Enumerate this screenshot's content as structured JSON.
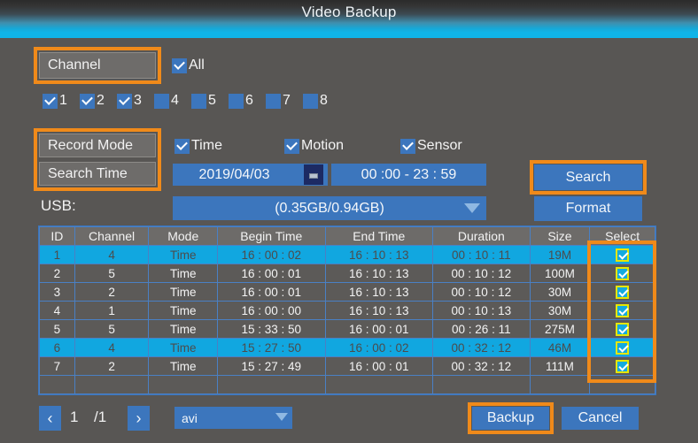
{
  "window": {
    "title": "Video Backup"
  },
  "colors": {
    "background": "#585654",
    "accent_blue": "#3c76bd",
    "highlight_orange": "#f08a1a",
    "row_selected_cyan": "#11a7e0",
    "title_accent": "#0fb4e8",
    "check_border_yellow": "#e6e600"
  },
  "channel_section": {
    "label": "Channel",
    "all": {
      "label": "All",
      "checked": true
    },
    "channels": [
      {
        "label": "1",
        "checked": true
      },
      {
        "label": "2",
        "checked": true
      },
      {
        "label": "3",
        "checked": true
      },
      {
        "label": "4",
        "checked": false
      },
      {
        "label": "5",
        "checked": false
      },
      {
        "label": "6",
        "checked": false
      },
      {
        "label": "7",
        "checked": false
      },
      {
        "label": "8",
        "checked": false
      }
    ]
  },
  "record_mode": {
    "label": "Record Mode",
    "modes": [
      {
        "label": "Time",
        "checked": true
      },
      {
        "label": "Motion",
        "checked": true
      },
      {
        "label": "Sensor",
        "checked": true
      }
    ]
  },
  "search_time": {
    "label": "Search Time",
    "date": "2019/04/03",
    "calendar_icon": "calendar-icon",
    "time_range": "00 :00  -  23 : 59",
    "start_time": "00:00",
    "end_time": "23:59"
  },
  "usb": {
    "label": "USB:",
    "value": "(0.35GB/0.94GB)",
    "used_gb": "0.35GB",
    "total_gb": "0.94GB"
  },
  "actions": {
    "search": "Search",
    "format": "Format",
    "backup": "Backup",
    "cancel": "Cancel"
  },
  "table": {
    "columns": [
      "ID",
      "Channel",
      "Mode",
      "Begin Time",
      "End Time",
      "Duration",
      "Size",
      "Select"
    ],
    "rows": [
      {
        "id": "1",
        "channel": "4",
        "mode": "Time",
        "begin": "16 : 00 : 02",
        "end": "16 : 10 : 13",
        "duration": "00 : 10 : 11",
        "size": "19M",
        "select": true,
        "highlighted": true
      },
      {
        "id": "2",
        "channel": "5",
        "mode": "Time",
        "begin": "16 : 00 : 01",
        "end": "16 : 10 : 13",
        "duration": "00 : 10 : 12",
        "size": "100M",
        "select": true,
        "highlighted": false
      },
      {
        "id": "3",
        "channel": "2",
        "mode": "Time",
        "begin": "16 : 00 : 01",
        "end": "16 : 10 : 13",
        "duration": "00 : 10 : 12",
        "size": "30M",
        "select": true,
        "highlighted": false
      },
      {
        "id": "4",
        "channel": "1",
        "mode": "Time",
        "begin": "16 : 00 : 00",
        "end": "16 : 10 : 13",
        "duration": "00 : 10 : 13",
        "size": "30M",
        "select": true,
        "highlighted": false
      },
      {
        "id": "5",
        "channel": "5",
        "mode": "Time",
        "begin": "15 : 33 : 50",
        "end": "16 : 00 : 01",
        "duration": "00 : 26 : 11",
        "size": "275M",
        "select": true,
        "highlighted": false
      },
      {
        "id": "6",
        "channel": "4",
        "mode": "Time",
        "begin": "15 : 27 : 50",
        "end": "16 : 00 : 02",
        "duration": "00 : 32 : 12",
        "size": "46M",
        "select": true,
        "highlighted": true
      },
      {
        "id": "7",
        "channel": "2",
        "mode": "Time",
        "begin": "15 : 27 : 49",
        "end": "16 : 00 : 01",
        "duration": "00 : 32 : 12",
        "size": "111M",
        "select": true,
        "highlighted": false
      },
      {
        "id": "",
        "channel": "",
        "mode": "",
        "begin": "",
        "end": "",
        "duration": "",
        "size": "",
        "select": false,
        "highlighted": false
      }
    ]
  },
  "pager": {
    "prev_icon": "chevron-left-icon",
    "next_icon": "chevron-right-icon",
    "current_page": "1",
    "total_pages": "/1",
    "format_select": "avi",
    "format_dropdown_icon": "chevron-down-icon"
  }
}
